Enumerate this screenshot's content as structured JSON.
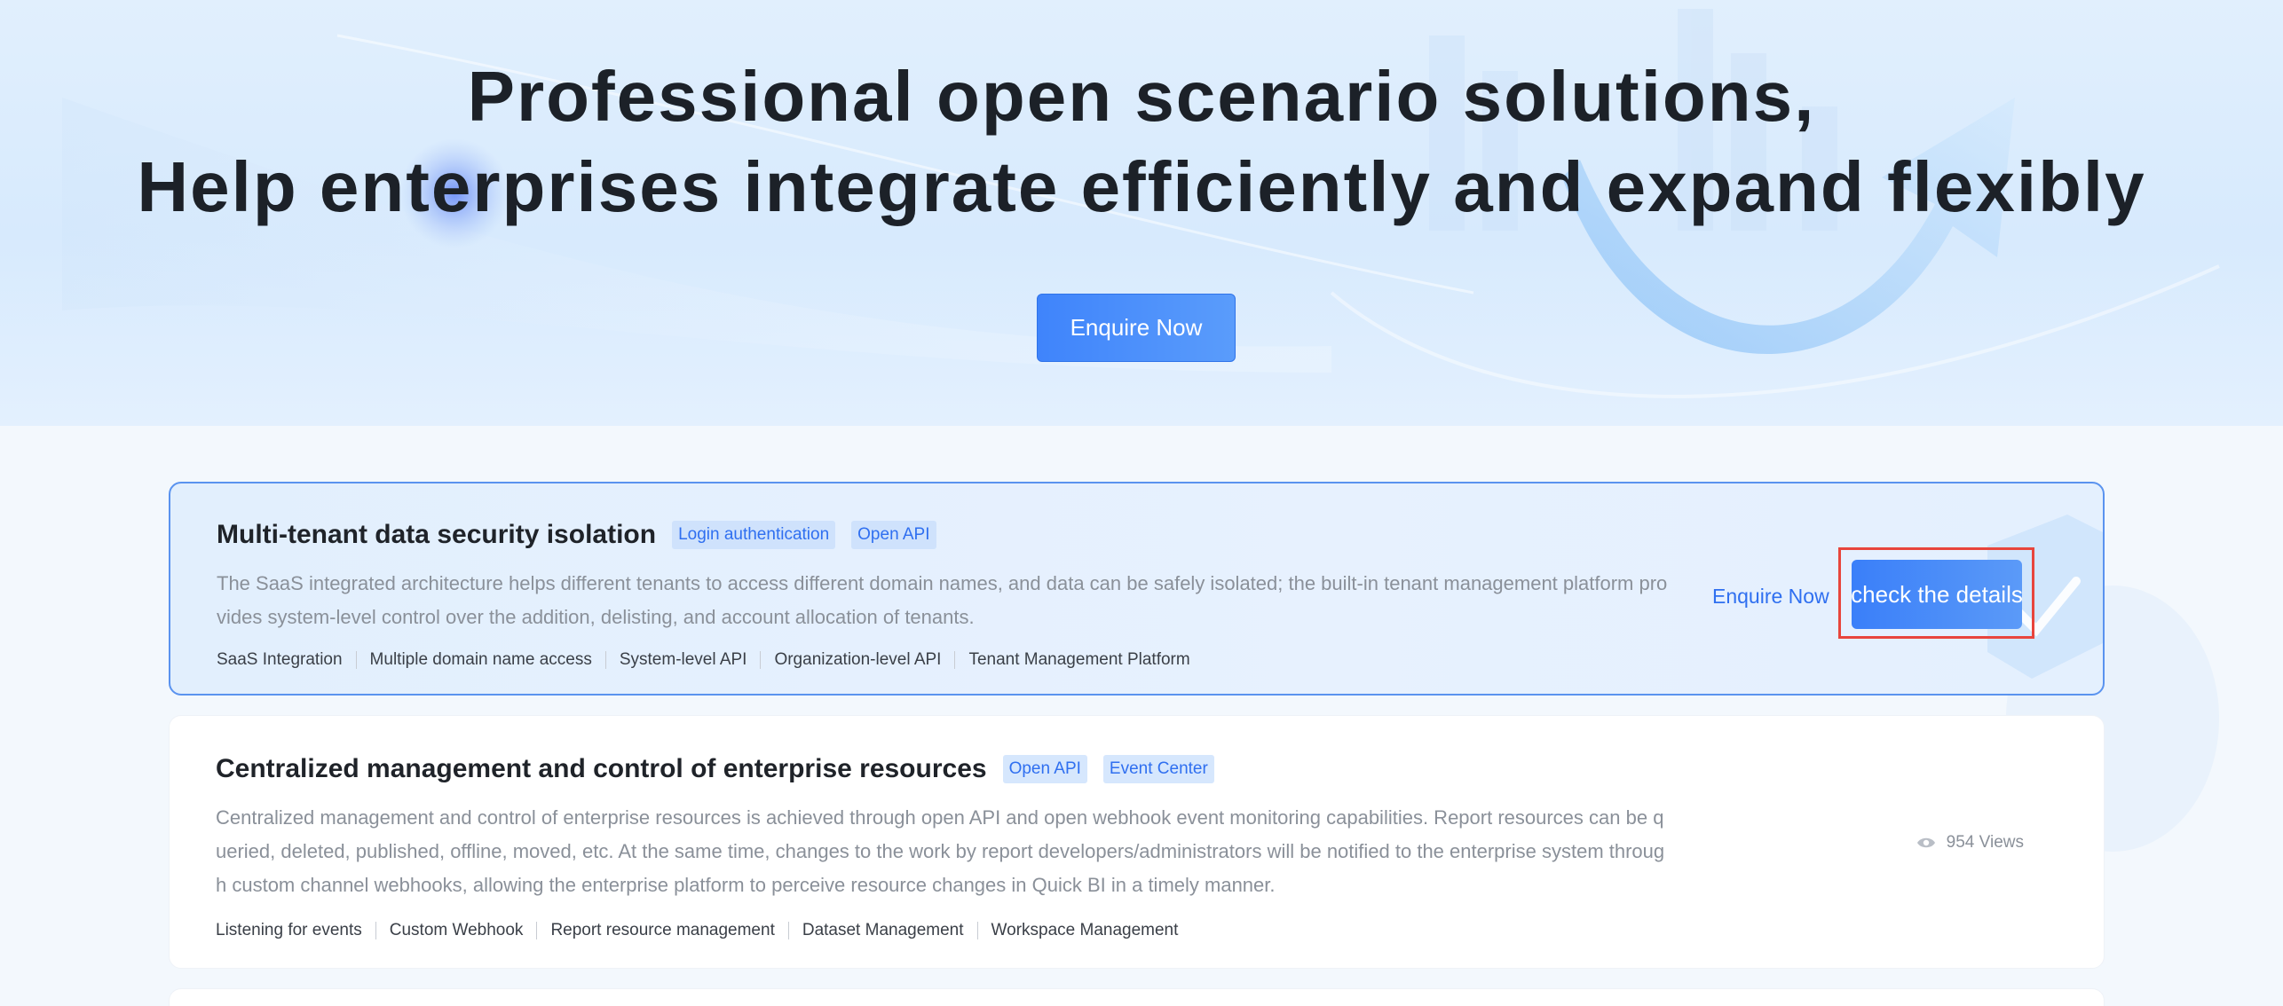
{
  "hero": {
    "title_line1": "Professional open scenario solutions,",
    "title_line2": "Help enterprises integrate efficiently and expand flexibly",
    "enquire_label": "Enquire Now"
  },
  "solutions": [
    {
      "title": "Multi-tenant data security isolation",
      "tags": [
        "Login authentication",
        "Open API"
      ],
      "description": "The SaaS integrated architecture helps different tenants to access different domain names, and data can be safely isolated; the built-in tenant management platform provides system-level control over the addition, delisting, and account allocation of tenants.",
      "keywords": [
        "SaaS Integration",
        "Multiple domain name access",
        "System-level API",
        "Organization-level API",
        "Tenant Management Platform"
      ],
      "enquire_label": "Enquire Now",
      "details_label": "check the details"
    },
    {
      "title": "Centralized management and control of enterprise resources",
      "tags": [
        "Open API",
        "Event Center"
      ],
      "description": "Centralized management and control of enterprise resources is achieved through open API and open webhook event monitoring capabilities. Report resources can be queried, deleted, published, offline, moved, etc. At the same time, changes to the work by report developers/administrators will be notified to the enterprise system through custom channel webhooks, allowing the enterprise platform to perceive resource changes in Quick BI in a timely manner.",
      "keywords": [
        "Listening for events",
        "Custom Webhook",
        "Report resource management",
        "Dataset Management",
        "Workspace Management"
      ],
      "views": "954 Views"
    }
  ],
  "colors": {
    "accent": "#3f84fb",
    "link": "#2f6ff0",
    "highlight": "#e8453c"
  },
  "icons": [
    "eye-icon",
    "arrow-decoration-icon",
    "shield-decoration-icon"
  ]
}
